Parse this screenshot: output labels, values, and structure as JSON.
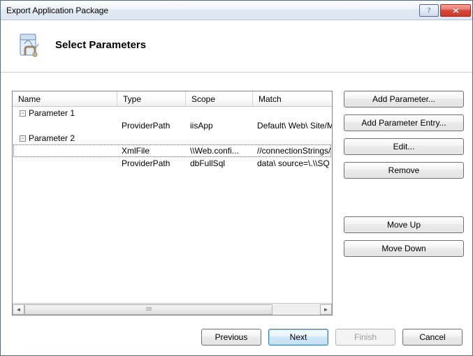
{
  "window": {
    "title": "Export Application Package"
  },
  "header": {
    "heading": "Select Parameters"
  },
  "grid": {
    "columns": {
      "name": "Name",
      "type": "Type",
      "scope": "Scope",
      "match": "Match"
    },
    "groups": [
      {
        "label": "Parameter 1",
        "rows": [
          {
            "type": "ProviderPath",
            "scope": "iisApp",
            "match": "Default\\ Web\\ Site/MyApp"
          }
        ]
      },
      {
        "label": "Parameter 2",
        "rows": [
          {
            "type": "XmlFile",
            "scope": "\\\\Web.confi...",
            "match": "//connectionStrings/"
          },
          {
            "type": "ProviderPath",
            "scope": "dbFullSql",
            "match": "data\\ source=\\.\\\\SQ"
          }
        ]
      }
    ],
    "selected": {
      "group": 1,
      "row": 0
    }
  },
  "side": {
    "add_parameter": "Add Parameter...",
    "add_entry": "Add Parameter Entry...",
    "edit": "Edit...",
    "remove": "Remove",
    "move_up": "Move Up",
    "move_down": "Move Down"
  },
  "footer": {
    "previous": "Previous",
    "next": "Next",
    "finish": "Finish",
    "cancel": "Cancel"
  }
}
